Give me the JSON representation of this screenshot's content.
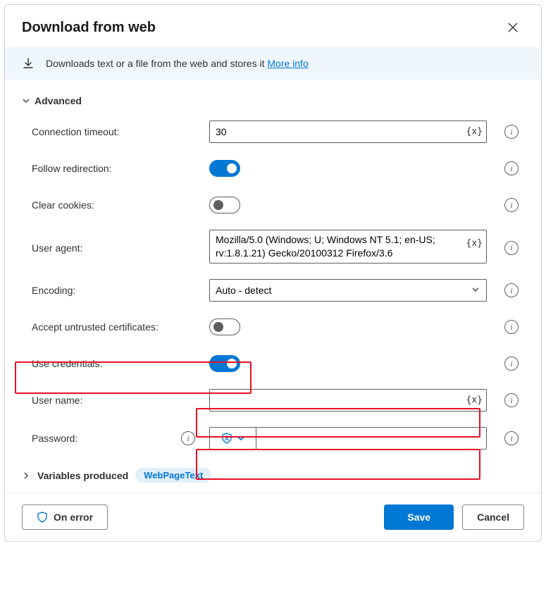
{
  "header": {
    "title": "Download from web"
  },
  "banner": {
    "text": "Downloads text or a file from the web and stores it ",
    "link_text": "More info"
  },
  "sections": {
    "advanced_label": "Advanced",
    "variables_label": "Variables produced",
    "variable_pill": "WebPageText"
  },
  "fields": {
    "connection_timeout": {
      "label": "Connection timeout:",
      "value": "30"
    },
    "follow_redirection": {
      "label": "Follow redirection:",
      "value": true
    },
    "clear_cookies": {
      "label": "Clear cookies:",
      "value": false
    },
    "user_agent": {
      "label": "User agent:",
      "value": "Mozilla/5.0 (Windows; U; Windows NT 5.1; en-US; rv:1.8.1.21) Gecko/20100312 Firefox/3.6"
    },
    "encoding": {
      "label": "Encoding:",
      "value": "Auto - detect"
    },
    "accept_untrusted": {
      "label": "Accept untrusted certificates:",
      "value": false
    },
    "use_credentials": {
      "label": "Use credentials:",
      "value": true
    },
    "user_name": {
      "label": "User name:",
      "value": ""
    },
    "password": {
      "label": "Password:",
      "value": ""
    }
  },
  "tokens": {
    "var_placeholder": "{x}"
  },
  "footer": {
    "on_error": "On error",
    "save": "Save",
    "cancel": "Cancel"
  }
}
